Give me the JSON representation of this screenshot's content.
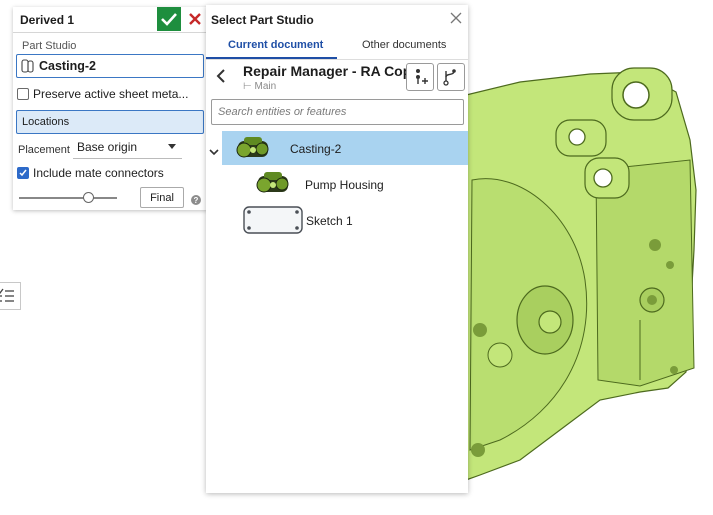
{
  "derived_panel": {
    "title": "Derived 1",
    "part_studio_label": "Part Studio",
    "part_studio_value": "Casting-2",
    "preserve_label": "Preserve active sheet meta...",
    "preserve_checked": false,
    "locations_label": "Locations",
    "placement_label": "Placement",
    "placement_value": "Base origin",
    "include_mate_label": "Include mate connectors",
    "include_mate_checked": true,
    "final_label": "Final",
    "slider_position": 0.72,
    "confirm_icon": "checkmark-icon",
    "cancel_icon": "close-x-icon",
    "help_icon": "help-icon"
  },
  "dialog": {
    "title": "Select Part Studio",
    "tabs": [
      {
        "label": "Current document",
        "active": true
      },
      {
        "label": "Other documents",
        "active": false
      }
    ],
    "document_name": "Repair Manager - RA Copy",
    "branch": "Main",
    "search_placeholder": "Search entities or features",
    "tree": [
      {
        "label": "Casting-2",
        "selected": true,
        "expanded": true,
        "thumbnail": "casting-thumbnail"
      },
      {
        "label": "Pump Housing",
        "selected": false,
        "thumbnail": "pump-housing-thumbnail"
      },
      {
        "label": "Sketch 1",
        "selected": false,
        "thumbnail": "sketch-thumbnail"
      }
    ]
  },
  "colors": {
    "model_green": "#c3e67a",
    "accent_blue": "#1f4fa6",
    "selection_blue": "#a9d3f0",
    "confirm_green": "#1e8e3e",
    "cancel_red": "#c62828"
  }
}
